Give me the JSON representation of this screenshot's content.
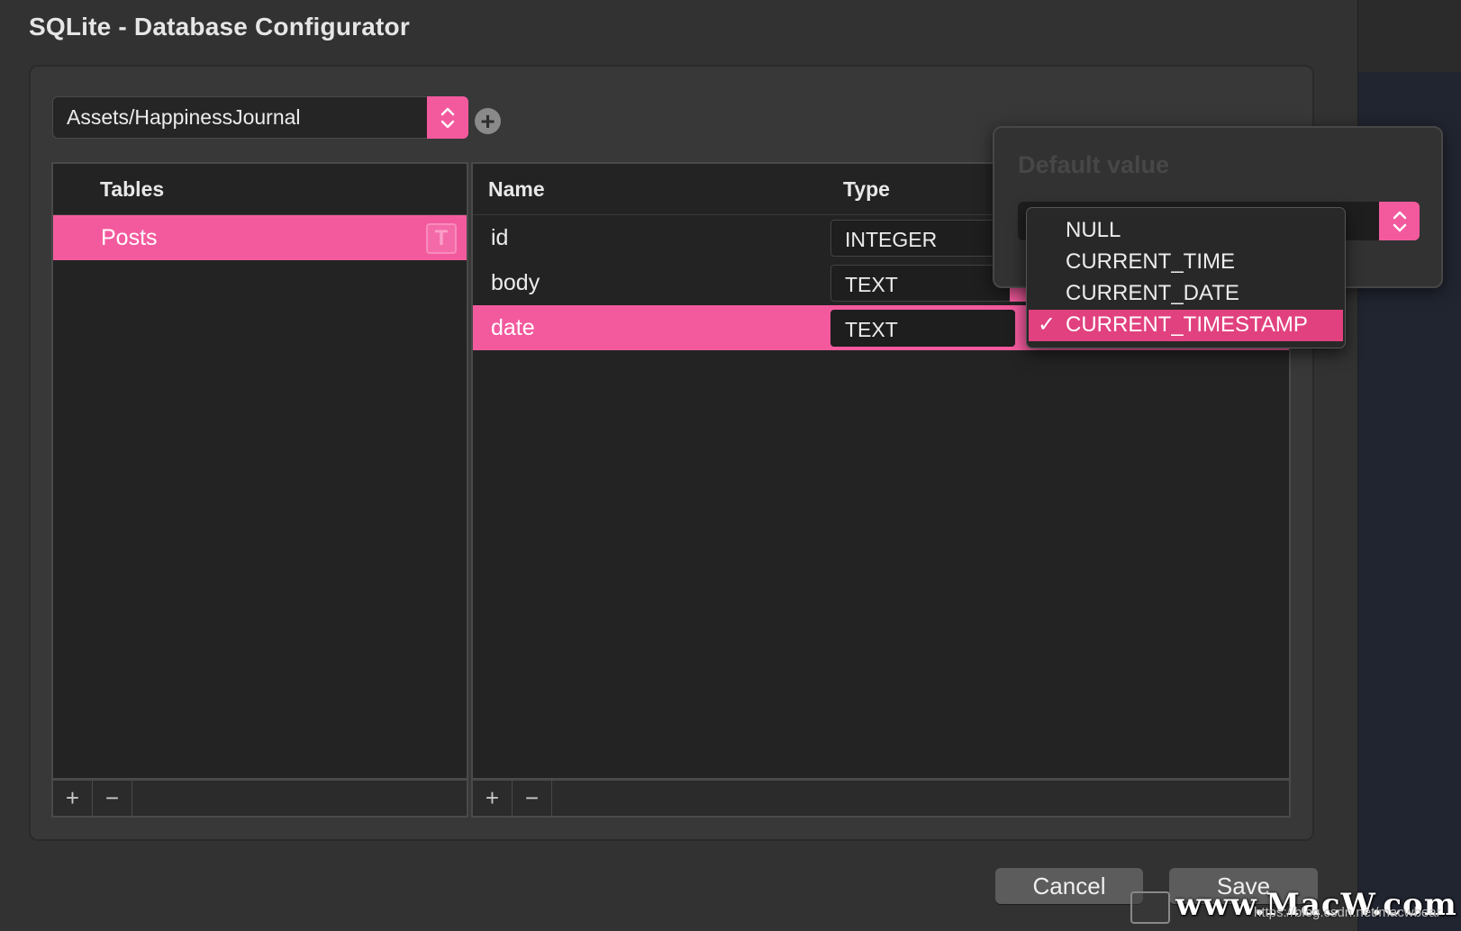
{
  "window": {
    "title": "SQLite - Database Configurator"
  },
  "database": {
    "path": "Assets/HappinessJournal",
    "add_label": "+"
  },
  "tables_list": {
    "header": "Tables",
    "items": [
      {
        "name": "Posts",
        "badge": "T",
        "selected": true
      }
    ]
  },
  "columns_list": {
    "headers": {
      "name": "Name",
      "type": "Type"
    },
    "rows": [
      {
        "name": "id",
        "type": "INTEGER",
        "selected": false
      },
      {
        "name": "body",
        "type": "TEXT",
        "selected": false
      },
      {
        "name": "date",
        "type": "TEXT",
        "selected": true
      }
    ]
  },
  "footer": {
    "add_label": "+",
    "remove_label": "−"
  },
  "default_value_popover": {
    "heading": "Default value",
    "options": [
      "NULL",
      "CURRENT_TIME",
      "CURRENT_DATE",
      "CURRENT_TIMESTAMP"
    ],
    "selected": "CURRENT_TIMESTAMP",
    "check_mark": "✓"
  },
  "buttons": {
    "cancel": "Cancel",
    "save": "Save"
  },
  "watermark": {
    "text": "www.MacW.com",
    "url": "https://blog.csdn.net/macwbear"
  },
  "colors": {
    "accent": "#f35a9e",
    "menu_selection": "#e1417f",
    "background": "#323232",
    "list_background": "#232323"
  }
}
